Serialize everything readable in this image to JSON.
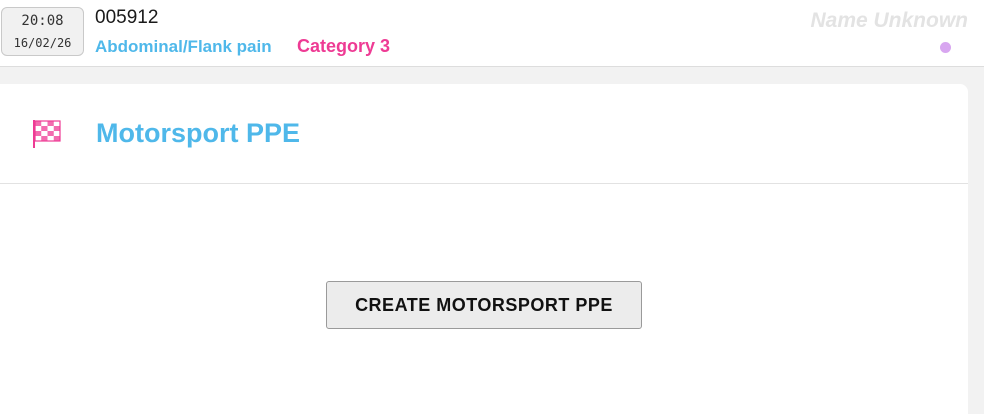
{
  "header": {
    "clock": {
      "time": "20:08",
      "date": "16/02/26"
    },
    "incident_id": "005912",
    "complaint": "Abdominal/Flank pain",
    "category": "Category 3",
    "patient_name": "Name Unknown",
    "status_dot_color": "#d8a6f0"
  },
  "card": {
    "icon": "checkered-flag-icon",
    "title": "Motorsport PPE",
    "create_button_label": "CREATE MOTORSPORT PPE"
  },
  "colors": {
    "accent_blue": "#4fb8ea",
    "accent_pink": "#ee3b94",
    "background": "#f2f2f2"
  }
}
